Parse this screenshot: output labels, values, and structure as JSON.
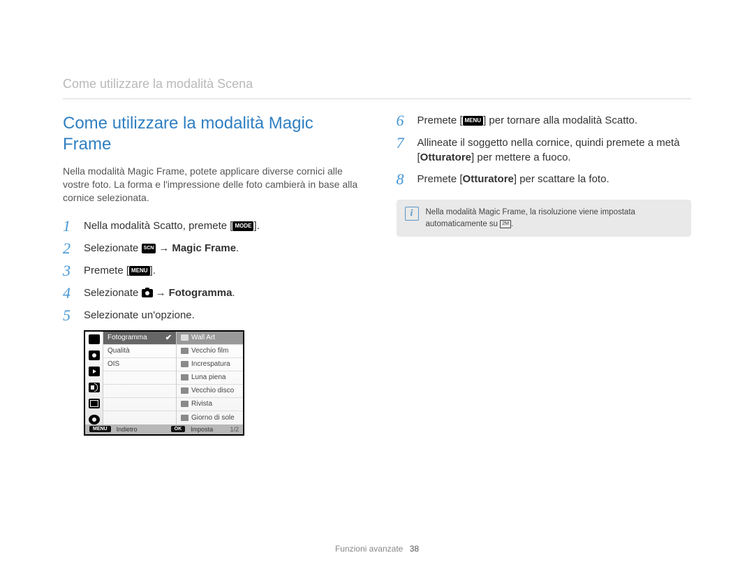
{
  "breadcrumb": "Come utilizzare la modalità Scena",
  "title": "Come utilizzare la modalità Magic Frame",
  "intro": "Nella modalità Magic Frame, potete applicare diverse cornici alle vostre foto. La forma e l'impressione delle foto cambierà in base alla cornice selezionata.",
  "icon": {
    "mode": "MODE",
    "menu": "MENU",
    "scn": "SCN",
    "ok": "OK",
    "res": "2M"
  },
  "steps_left": {
    "1": {
      "pre": "Nella modalità Scatto, premete [",
      "post": "]."
    },
    "2": {
      "pre": "Selezionate ",
      "arrow": "→",
      "bold": "Magic Frame",
      "post": "."
    },
    "3": {
      "pre": "Premete [",
      "post": "]."
    },
    "4": {
      "pre": "Selezionate ",
      "arrow": "→",
      "bold": "Fotogramma",
      "post": "."
    },
    "5": {
      "text": "Selezionate un'opzione."
    }
  },
  "steps_right": {
    "6": {
      "pre": "Premete [",
      "post": "] per tornare alla modalità Scatto."
    },
    "7": {
      "a": "Allineate il soggetto nella cornice, quindi premete a metà [",
      "bold": "Otturatore",
      "b": "] per mettere a fuoco."
    },
    "8": {
      "a": "Premete [",
      "bold": "Otturatore",
      "b": "] per scattare la foto."
    }
  },
  "note": {
    "a": "Nella modalità Magic Frame, la risoluzione viene impostata automaticamente su ",
    "b": "."
  },
  "cam": {
    "mid": {
      "1": "Fotogramma",
      "2": "Qualità",
      "3": "OIS"
    },
    "right": {
      "1": "Wall Art",
      "2": "Vecchio film",
      "3": "Increspatura",
      "4": "Luna piena",
      "5": "Vecchio disco",
      "6": "Rivista",
      "7": "Giorno di sole"
    },
    "bottom": {
      "back": "Indietro",
      "set": "Imposta",
      "page": "1/2"
    }
  },
  "footer": {
    "section": "Funzioni avanzate",
    "page": "38"
  }
}
